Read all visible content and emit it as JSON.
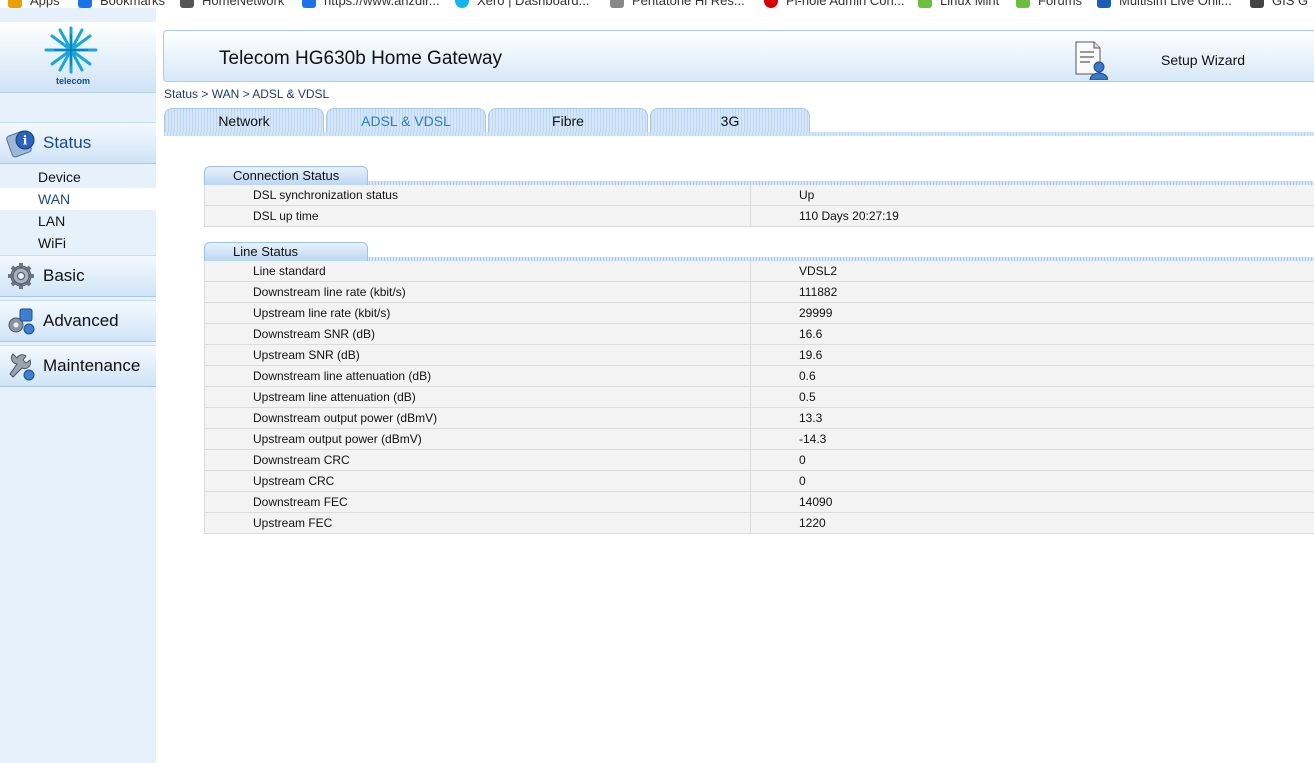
{
  "bookmarks": [
    {
      "label": "Apps",
      "color": "#e8a000"
    },
    {
      "label": "Bookmarks",
      "color": "#1a73e8"
    },
    {
      "label": "HomeNetwork",
      "color": "#555555"
    },
    {
      "label": "https://www.anzdir...",
      "color": "#1a73e8"
    },
    {
      "label": "Xero | Dashboard...",
      "color": "#13b5ea"
    },
    {
      "label": "Pentatone Hi Res...",
      "color": "#888888"
    },
    {
      "label": "Pi-hole Admin Con...",
      "color": "#d40000"
    },
    {
      "label": "Linux Mint",
      "color": "#6cbf3c"
    },
    {
      "label": "Forums",
      "color": "#6cbf3c"
    },
    {
      "label": "Multisim Live Onli...",
      "color": "#1a5fb4"
    },
    {
      "label": "GIS G",
      "color": "#444444"
    }
  ],
  "logo": {
    "text": "telecom",
    "color": "#19a7d8"
  },
  "sidebar": {
    "sections": [
      {
        "label": "Status",
        "icon": "status-info-icon",
        "active": true,
        "items": [
          {
            "label": "Device"
          },
          {
            "label": "WAN",
            "active": true
          },
          {
            "label": "LAN"
          },
          {
            "label": "WiFi"
          }
        ]
      },
      {
        "label": "Basic",
        "icon": "gear-icon"
      },
      {
        "label": "Advanced",
        "icon": "advanced-tools-icon"
      },
      {
        "label": "Maintenance",
        "icon": "maintenance-wrench-icon"
      }
    ]
  },
  "header": {
    "title": "Telecom HG630b Home Gateway",
    "wizard_label": "Setup Wizard",
    "wizard_icon": "setup-wizard-icon"
  },
  "breadcrumb": "Status > WAN > ADSL & VDSL",
  "tabs": [
    {
      "label": "Network"
    },
    {
      "label": "ADSL & VDSL",
      "active": true
    },
    {
      "label": "Fibre"
    },
    {
      "label": "3G"
    }
  ],
  "connection_status": {
    "title": "Connection Status",
    "rows": [
      {
        "key": "DSL synchronization status",
        "value": "Up"
      },
      {
        "key": "DSL up time",
        "value": "110 Days 20:27:19"
      }
    ]
  },
  "line_status": {
    "title": "Line Status",
    "rows": [
      {
        "key": "Line standard",
        "value": "VDSL2"
      },
      {
        "key": "Downstream line rate (kbit/s)",
        "value": "111882"
      },
      {
        "key": "Upstream line rate (kbit/s)",
        "value": "29999"
      },
      {
        "key": "Downstream SNR (dB)",
        "value": "16.6"
      },
      {
        "key": "Upstream SNR (dB)",
        "value": "19.6"
      },
      {
        "key": "Downstream line attenuation (dB)",
        "value": "0.6"
      },
      {
        "key": "Upstream line attenuation (dB)",
        "value": "0.5"
      },
      {
        "key": "Downstream output power (dBmV)",
        "value": "13.3"
      },
      {
        "key": "Upstream output power (dBmV)",
        "value": "-14.3"
      },
      {
        "key": "Downstream CRC",
        "value": "0"
      },
      {
        "key": "Upstream CRC",
        "value": "0"
      },
      {
        "key": "Downstream FEC",
        "value": "14090"
      },
      {
        "key": "Upstream FEC",
        "value": "1220"
      }
    ]
  }
}
